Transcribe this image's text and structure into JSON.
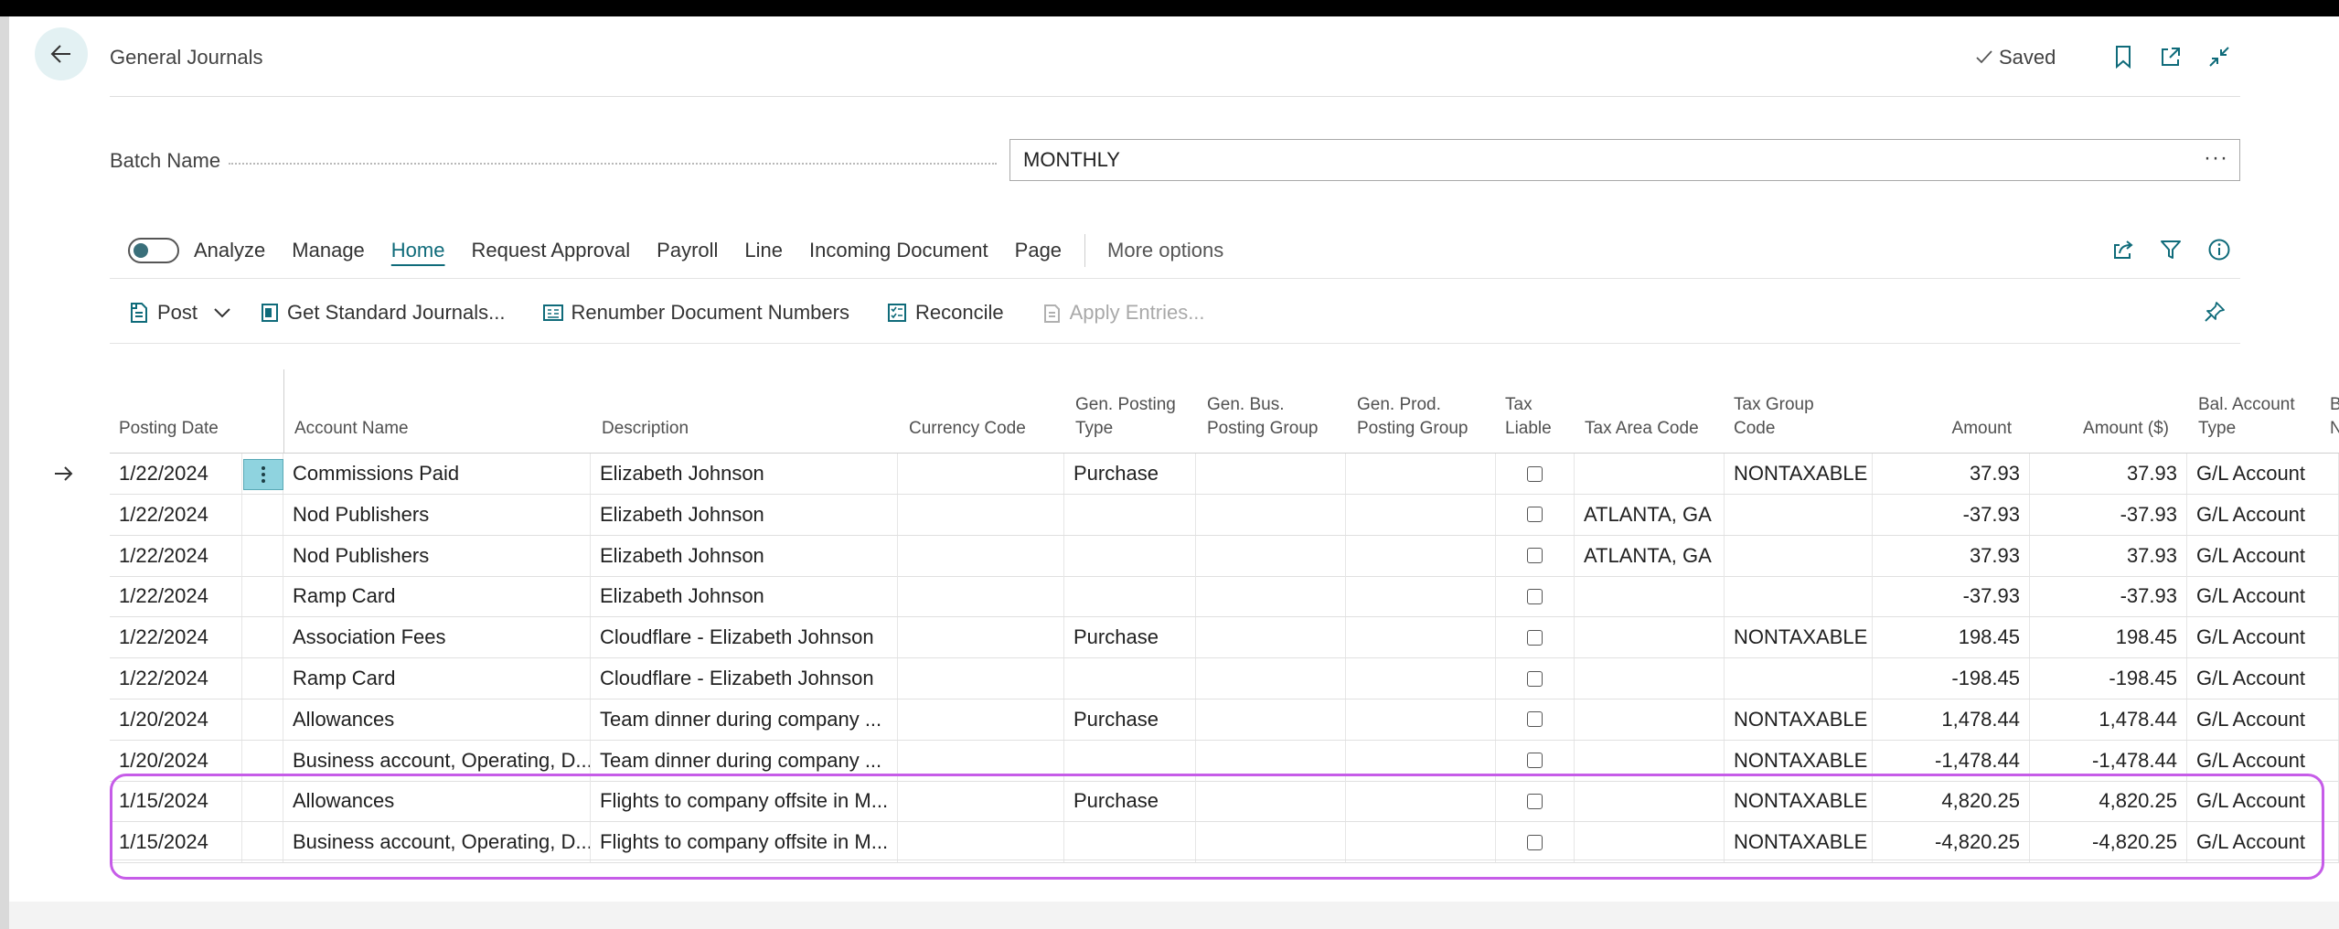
{
  "header": {
    "title": "General Journals",
    "saved_label": "Saved"
  },
  "batch": {
    "label": "Batch Name",
    "value": "MONTHLY",
    "more": "···"
  },
  "menu": {
    "analyze": "Analyze",
    "manage": "Manage",
    "home": "Home",
    "request_approval": "Request Approval",
    "payroll": "Payroll",
    "line": "Line",
    "incoming_document": "Incoming Document",
    "page": "Page",
    "more_options": "More options"
  },
  "actions": {
    "post": "Post",
    "get_standard_journals": "Get Standard Journals...",
    "renumber": "Renumber Document Numbers",
    "reconcile": "Reconcile",
    "apply_entries": "Apply Entries..."
  },
  "columns": {
    "posting_date": "Posting Date",
    "account_name": "Account Name",
    "description": "Description",
    "currency_code": "Currency Code",
    "gen_posting_type_1": "Gen. Posting",
    "gen_posting_type_2": "Type",
    "gen_bus_1": "Gen. Bus.",
    "gen_bus_2": "Posting Group",
    "gen_prod_1": "Gen. Prod.",
    "gen_prod_2": "Posting Group",
    "tax_liable_1": "Tax",
    "tax_liable_2": "Liable",
    "tax_area_code": "Tax Area Code",
    "tax_group_1": "Tax Group",
    "tax_group_2": "Code",
    "amount": "Amount",
    "amount_usd": "Amount ($)",
    "bal_account_1": "Bal. Account",
    "bal_account_2": "Type",
    "next_1": "B",
    "next_2": "N"
  },
  "rows": [
    {
      "date": "1/22/2024",
      "account": "Commissions Paid",
      "description": "Elizabeth Johnson",
      "currency": "",
      "gen_posting_type": "Purchase",
      "gen_bus": "",
      "gen_prod": "",
      "tax_area": "",
      "tax_group": "NONTAXABLE",
      "amount": "37.93",
      "amount_usd": "37.93",
      "bal_type": "G/L Account"
    },
    {
      "date": "1/22/2024",
      "account": "Nod Publishers",
      "description": "Elizabeth Johnson",
      "currency": "",
      "gen_posting_type": "",
      "gen_bus": "",
      "gen_prod": "",
      "tax_area": "ATLANTA, GA",
      "tax_group": "",
      "amount": "-37.93",
      "amount_usd": "-37.93",
      "bal_type": "G/L Account"
    },
    {
      "date": "1/22/2024",
      "account": "Nod Publishers",
      "description": "Elizabeth Johnson",
      "currency": "",
      "gen_posting_type": "",
      "gen_bus": "",
      "gen_prod": "",
      "tax_area": "ATLANTA, GA",
      "tax_group": "",
      "amount": "37.93",
      "amount_usd": "37.93",
      "bal_type": "G/L Account"
    },
    {
      "date": "1/22/2024",
      "account": "Ramp Card",
      "description": "Elizabeth Johnson",
      "currency": "",
      "gen_posting_type": "",
      "gen_bus": "",
      "gen_prod": "",
      "tax_area": "",
      "tax_group": "",
      "amount": "-37.93",
      "amount_usd": "-37.93",
      "bal_type": "G/L Account"
    },
    {
      "date": "1/22/2024",
      "account": "Association Fees",
      "description": "Cloudflare - Elizabeth Johnson",
      "currency": "",
      "gen_posting_type": "Purchase",
      "gen_bus": "",
      "gen_prod": "",
      "tax_area": "",
      "tax_group": "NONTAXABLE",
      "amount": "198.45",
      "amount_usd": "198.45",
      "bal_type": "G/L Account"
    },
    {
      "date": "1/22/2024",
      "account": "Ramp Card",
      "description": "Cloudflare - Elizabeth Johnson",
      "currency": "",
      "gen_posting_type": "",
      "gen_bus": "",
      "gen_prod": "",
      "tax_area": "",
      "tax_group": "",
      "amount": "-198.45",
      "amount_usd": "-198.45",
      "bal_type": "G/L Account"
    },
    {
      "date": "1/20/2024",
      "account": "Allowances",
      "description": "Team dinner during company ...",
      "currency": "",
      "gen_posting_type": "Purchase",
      "gen_bus": "",
      "gen_prod": "",
      "tax_area": "",
      "tax_group": "NONTAXABLE",
      "amount": "1,478.44",
      "amount_usd": "1,478.44",
      "bal_type": "G/L Account"
    },
    {
      "date": "1/20/2024",
      "account": "Business account, Operating, D...",
      "description": "Team dinner during company ...",
      "currency": "",
      "gen_posting_type": "",
      "gen_bus": "",
      "gen_prod": "",
      "tax_area": "",
      "tax_group": "NONTAXABLE",
      "amount": "-1,478.44",
      "amount_usd": "-1,478.44",
      "bal_type": "G/L Account"
    },
    {
      "date": "1/15/2024",
      "account": "Allowances",
      "description": "Flights to company offsite in M...",
      "currency": "",
      "gen_posting_type": "Purchase",
      "gen_bus": "",
      "gen_prod": "",
      "tax_area": "",
      "tax_group": "NONTAXABLE",
      "amount": "4,820.25",
      "amount_usd": "4,820.25",
      "bal_type": "G/L Account"
    },
    {
      "date": "1/15/2024",
      "account": "Business account, Operating, D...",
      "description": "Flights to company offsite in M...",
      "currency": "",
      "gen_posting_type": "",
      "gen_bus": "",
      "gen_prod": "",
      "tax_area": "",
      "tax_group": "NONTAXABLE",
      "amount": "-4,820.25",
      "amount_usd": "-4,820.25",
      "bal_type": "G/L Account"
    }
  ],
  "colors": {
    "accent": "#0f6b7a",
    "selected_cell": "#8fd3df",
    "highlight": "#c65ce8"
  }
}
